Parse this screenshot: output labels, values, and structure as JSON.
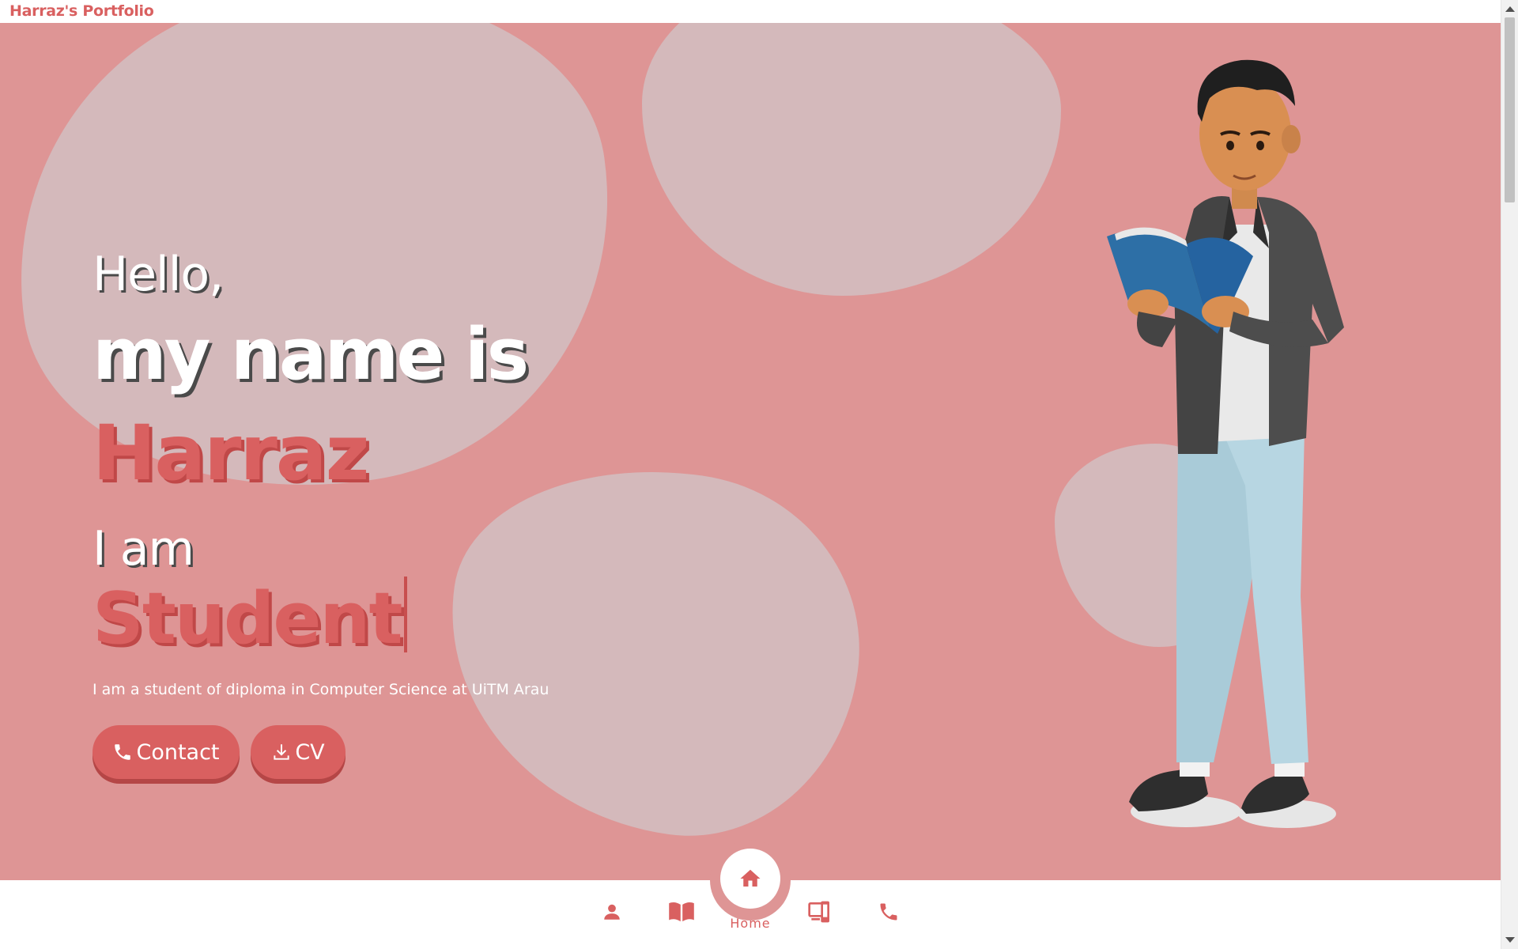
{
  "header": {
    "brand": "Harraz's Portfolio"
  },
  "hero": {
    "greeting": "Hello,",
    "name_intro": "my name is",
    "name": "Harraz",
    "role_intro": "I am",
    "role": "Student",
    "description": "I am a student of diploma in Computer Science at UiTM Arau",
    "buttons": {
      "contact_label": "Contact",
      "cv_label": "CV"
    },
    "illustration": "student-reading-book"
  },
  "bottom_nav": {
    "items": [
      {
        "id": "about",
        "icon": "user-icon"
      },
      {
        "id": "education",
        "icon": "book-icon"
      },
      {
        "id": "home",
        "icon": "home-icon",
        "label": "Home",
        "active": true
      },
      {
        "id": "projects",
        "icon": "devices-icon"
      },
      {
        "id": "contact",
        "icon": "phone-icon"
      }
    ]
  },
  "colors": {
    "accent": "#d96060",
    "hero_background": "#de9595",
    "blob": "#d4b9bb",
    "text_on_hero": "#ffffff"
  }
}
